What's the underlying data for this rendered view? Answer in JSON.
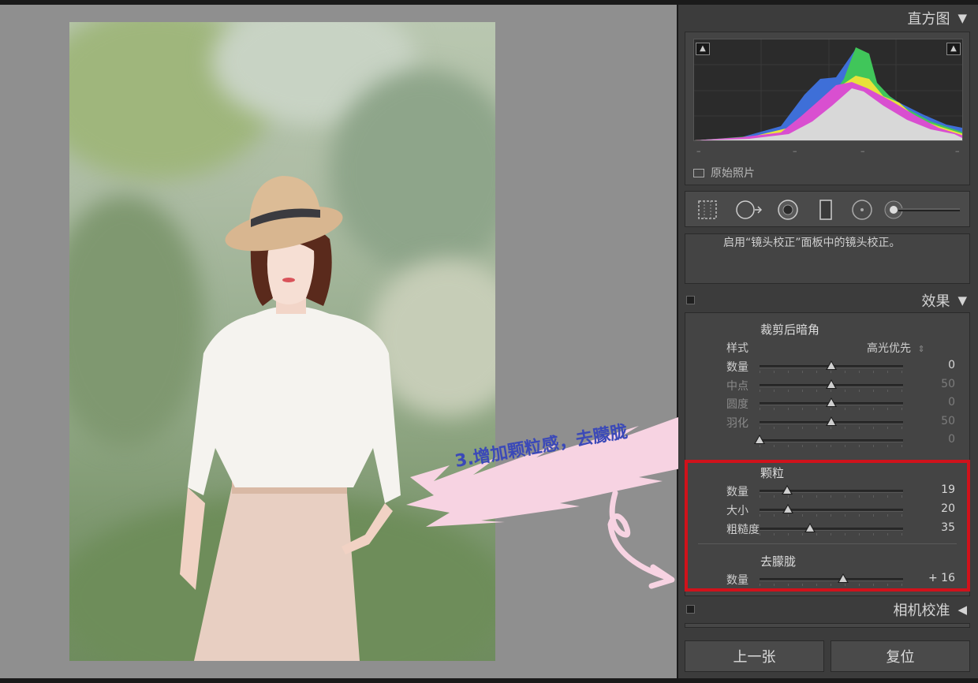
{
  "histogram": {
    "title": "直方图",
    "collapse_icon": "triangle-down-icon",
    "ticks": [
      "–",
      "–",
      "–",
      "–"
    ],
    "original_photo_label": "原始照片"
  },
  "lens_note": "启用“镜头校正”面板中的镜头校正。",
  "effects": {
    "title": "效果",
    "vignette": {
      "title": "裁剪后暗角",
      "style_label": "样式",
      "style_value": "高光优先",
      "sliders": [
        {
          "label": "数量",
          "value": "0",
          "fraction": 0.5,
          "enabled": true
        },
        {
          "label": "中点",
          "value": "50",
          "fraction": 0.5,
          "enabled": false
        },
        {
          "label": "圆度",
          "value": "0",
          "fraction": 0.5,
          "enabled": false
        },
        {
          "label": "羽化",
          "value": "50",
          "fraction": 0.5,
          "enabled": false
        },
        {
          "label": "",
          "value": "0",
          "fraction": 0.0,
          "enabled": false
        }
      ]
    },
    "grain": {
      "title": "颗粒",
      "sliders": [
        {
          "label": "数量",
          "value": "19",
          "fraction": 0.19
        },
        {
          "label": "大小",
          "value": "20",
          "fraction": 0.2
        },
        {
          "label": "粗糙度",
          "value": "35",
          "fraction": 0.35
        }
      ]
    },
    "dehaze": {
      "title": "去朦胧",
      "sliders": [
        {
          "label": "数量",
          "value": "+ 16",
          "fraction": 0.58
        }
      ]
    }
  },
  "camera_calibration": {
    "title": "相机校准",
    "expand_icon": "triangle-left-icon"
  },
  "buttons": {
    "previous": "上一张",
    "reset": "复位"
  },
  "annotation": {
    "text": "3.增加颗粒感，去朦胧"
  },
  "colors": {
    "highlight_box": "#d0121b",
    "annotation_text": "#3b49b8",
    "annotation_brush": "#f7d3e2"
  }
}
